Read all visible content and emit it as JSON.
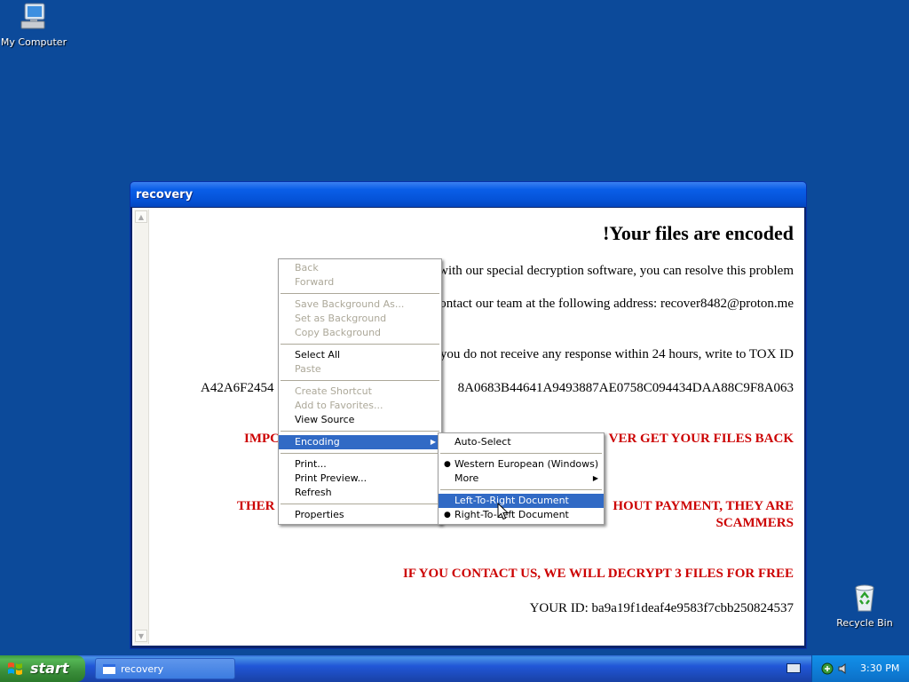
{
  "desktop": {
    "icons": [
      {
        "label": "My Computer"
      },
      {
        "label": "Recycle Bin"
      }
    ]
  },
  "window": {
    "title": "recovery",
    "content": {
      "headline": "!Your files are encoded",
      "line1": "with our special decryption software, you can resolve this problem",
      "line2": "ontact our team at the following address: recover8482@proton.me",
      "line3": "you do not receive any response within 24 hours, write to TOX ID",
      "tox_left": "A42A6F2454",
      "tox_right": "8A0683B44641A9493887AE0758C094434DAA88C9F8A063",
      "warn1_left": "IMPC",
      "warn1_right": "VER GET YOUR FILES BACK",
      "warn2_left": "THER",
      "warn2_right": "HOUT PAYMENT, THEY ARE",
      "warn2_line2": "SCAMMERS",
      "offer": "IF YOU CONTACT US, WE WILL DECRYPT 3 FILES FOR FREE",
      "your_id": "YOUR ID: ba9a19f1deaf4e9583f7cbb250824537"
    }
  },
  "context_menu": {
    "back": "Back",
    "forward": "Forward",
    "save_background": "Save Background As...",
    "set_background": "Set as Background",
    "copy_background": "Copy Background",
    "select_all": "Select All",
    "paste": "Paste",
    "create_shortcut": "Create Shortcut",
    "add_favorites": "Add to Favorites...",
    "view_source": "View Source",
    "encoding": "Encoding",
    "print": "Print...",
    "print_preview": "Print Preview...",
    "refresh": "Refresh",
    "properties": "Properties"
  },
  "encoding_submenu": {
    "auto_select": "Auto-Select",
    "western_european": "Western European (Windows)",
    "more": "More",
    "ltr": "Left-To-Right Document",
    "rtl": "Right-To-Left Document"
  },
  "taskbar": {
    "start_label": "start",
    "task_button": "recovery",
    "clock": "3:30 PM"
  },
  "colors": {
    "desktop": "#0c4a9a",
    "warning_red": "#cc0000",
    "menu_highlight": "#316ac5"
  }
}
